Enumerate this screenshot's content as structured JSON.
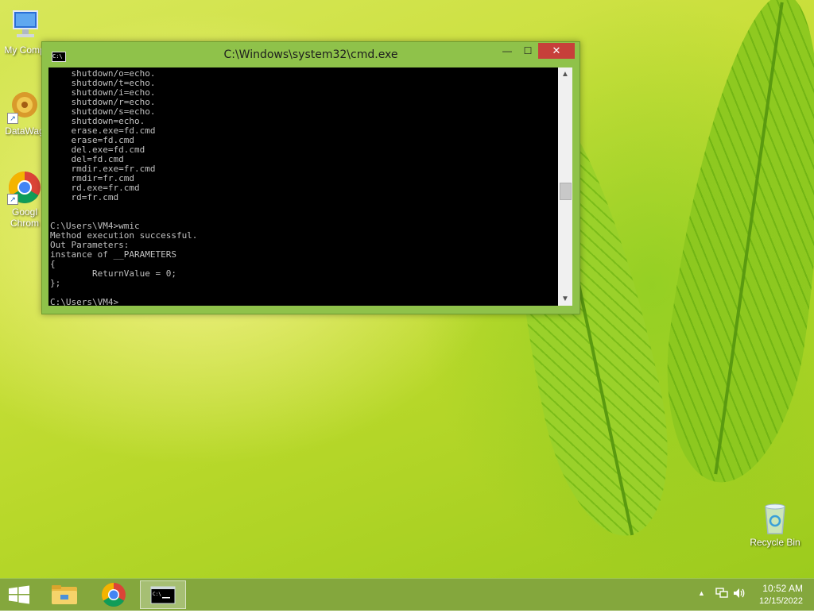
{
  "window": {
    "title": "C:\\Windows\\system32\\cmd.exe",
    "minimize_label": "—",
    "maximize_label": "☐",
    "close_label": "✕"
  },
  "console": {
    "lines": [
      "    shutdown/o=echo.",
      "    shutdown/t=echo.",
      "    shutdown/i=echo.",
      "    shutdown/r=echo.",
      "    shutdown/s=echo.",
      "    shutdown=echo.",
      "    erase.exe=fd.cmd",
      "    erase=fd.cmd",
      "    del.exe=fd.cmd",
      "    del=fd.cmd",
      "    rmdir.exe=fr.cmd",
      "    rmdir=fr.cmd",
      "    rd.exe=fr.cmd",
      "    rd=fr.cmd",
      "",
      "",
      "C:\\Users\\VM4>wmic",
      "Method execution successful.",
      "Out Parameters:",
      "instance of __PARAMETERS",
      "{",
      "        ReturnValue = 0;",
      "};",
      "",
      "C:\\Users\\VM4>"
    ]
  },
  "desktop_icons": {
    "my_computer": "My Comp",
    "datawag": "DataWag",
    "chrome": "Googl Chrom",
    "recycle_bin": "Recycle Bin"
  },
  "taskbar": {
    "items": [
      "start",
      "file-explorer",
      "google-chrome",
      "command-prompt"
    ],
    "active": "command-prompt"
  },
  "tray": {
    "time": "10:52 AM",
    "date": "12/15/2022",
    "icons": [
      "chevron-up-icon",
      "network-icon",
      "volume-icon"
    ]
  },
  "colors": {
    "taskbar": "#7aa02c",
    "close_button": "#c7403a",
    "window_frame": "#8fc24a"
  }
}
